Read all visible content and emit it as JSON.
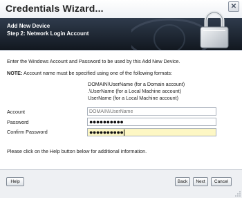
{
  "window": {
    "title": "Credentials Wizard...",
    "close_glyph": "✕"
  },
  "header": {
    "title": "Add New Device",
    "step": "Step 2: Network Login Account",
    "icon": "padlock-icon"
  },
  "body": {
    "instruction": "Enter the Windows Account and Password to be used by this Add New Device.",
    "note_label": "NOTE:",
    "note_text": "Account name must be specified using one of the following formats:",
    "formats": [
      "DOMAIN\\UserName (for a Domain account)",
      ".\\UserName (for a Local Machine account)",
      "UserName (for a Local Machine account)"
    ],
    "fields": {
      "account": {
        "label": "Account",
        "placeholder": "DOMAIN\\UserName",
        "value": ""
      },
      "password": {
        "label": "Password",
        "value": "●●●●●●●●●●"
      },
      "confirm_password": {
        "label": "Confirm Password",
        "value": "●●●●●●●●●●"
      }
    },
    "help_text": "Please click on the Help button below for additional information."
  },
  "buttons": {
    "help": "Help",
    "back": "Back",
    "next": "Next",
    "cancel": "Cancel"
  },
  "colors": {
    "header_bg": "#1e2632",
    "confirm_highlight": "#fdf7c4"
  }
}
